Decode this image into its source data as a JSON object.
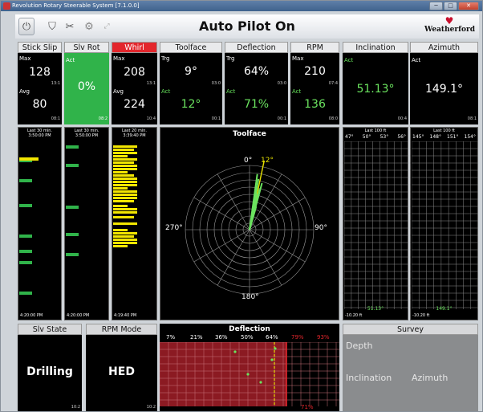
{
  "window": {
    "title": "Revolution Rotary Steerable System [7.1.0.0]",
    "minimize": "─",
    "maximize": "□",
    "close": "✕"
  },
  "toolbar": {
    "title": "Auto Pilot On",
    "logo": "Weatherford",
    "icons": [
      "power-icon",
      "shield-icon",
      "drill-icon",
      "gear-icon",
      "expand-icon"
    ]
  },
  "colors": {
    "panel": "#000000",
    "green": "#30b34a",
    "red": "#e3262c",
    "value_green": "#6be35f",
    "bar_yellow": "#f2e600",
    "deflection_bg": "#8b1a22"
  },
  "tiles": {
    "stickslip": {
      "title": "Stick Slip",
      "max_label": "Max",
      "max": "128",
      "time1": "13:1",
      "avg_label": "Avg",
      "avg": "80",
      "time2": "08:1"
    },
    "slvrot": {
      "title": "Slv Rot",
      "act_label": "Act",
      "value": "0%",
      "time": "08:2"
    },
    "whirl": {
      "title": "Whirl",
      "max_label": "Max",
      "max": "208",
      "time1": "13:1",
      "avg_label": "Avg",
      "avg": "224",
      "time2": "10:4"
    },
    "toolface": {
      "title": "Toolface",
      "trg_label": "Trg",
      "trg": "9°",
      "time1": "03:0",
      "act_label": "Act",
      "act": "12°",
      "time2": "00:1"
    },
    "deflection": {
      "title": "Deflection",
      "trg_label": "Trg",
      "trg": "64%",
      "time1": "03:0",
      "act_label": "Act",
      "act": "71%",
      "time2": "00:1"
    },
    "rpm": {
      "title": "RPM",
      "max_label": "Max",
      "max": "210",
      "time1": "07:4",
      "act_label": "Act",
      "act": "136",
      "time2": "08:0"
    },
    "inclination": {
      "title": "Inclination",
      "act_label": "Act",
      "value": "51.13°",
      "time": "00:4"
    },
    "azimuth": {
      "title": "Azimuth",
      "act_label": "Act",
      "value": "149.1°",
      "time": "08:1"
    }
  },
  "charts": {
    "ss": {
      "header": "Last 30 min.",
      "start": "3:50:00 PM",
      "end": "4:20:00 PM",
      "bar_color": "#30b34a",
      "bars": [
        [
          0.1,
          0.07
        ],
        [
          0.22,
          0.07
        ],
        [
          0.37,
          0.07
        ],
        [
          0.55,
          0.07
        ],
        [
          0.64,
          0.07
        ],
        [
          0.71,
          0.07
        ],
        [
          0.89,
          0.07
        ]
      ],
      "yellow": [
        [
          0.09,
          0.18
        ]
      ]
    },
    "sr": {
      "header": "Last 30 min.",
      "start": "3:50:00 PM",
      "end": "4:20:00 PM",
      "bar_color": "#30b34a",
      "bars": [
        [
          0.02,
          0.05
        ],
        [
          0.13,
          0.05
        ],
        [
          0.38,
          0.05
        ],
        [
          0.54,
          0.05
        ],
        [
          0.66,
          0.05
        ]
      ]
    },
    "wh": {
      "header": "Last 20 min.",
      "start": "3:39:40 PM",
      "end": "4:19:40 PM",
      "bar_color": "#f2e600"
    },
    "inc": {
      "header": "Last 100 ft",
      "ticks": [
        "47°",
        "50°",
        "53°",
        "56°"
      ],
      "value": "51.13°",
      "foot": "-10.20 ft"
    },
    "azi": {
      "header": "Last 100 ft",
      "ticks": [
        "145°",
        "148°",
        "151°",
        "154°"
      ],
      "value": "149.1°",
      "foot": "-10.20 ft"
    }
  },
  "polar": {
    "title": "Toolface",
    "labels": {
      "top": "0°",
      "right": "90°",
      "bottom": "180°",
      "left": "270°"
    },
    "target_label": "12°",
    "target_deg": 12
  },
  "bottom": {
    "slvstate": {
      "title": "Slv State",
      "value": "Drilling",
      "time": "10:2"
    },
    "rpmmode": {
      "title": "RPM Mode",
      "value": "HED",
      "time": "10:2"
    },
    "deflection": {
      "title": "Deflection",
      "ticks": [
        "7%",
        "21%",
        "36%",
        "50%",
        "64%",
        "79%",
        "93%"
      ],
      "value": "71%"
    },
    "survey": {
      "title": "Survey",
      "depth_label": "Depth",
      "inclination_label": "Inclination",
      "azimuth_label": "Azimuth"
    }
  }
}
